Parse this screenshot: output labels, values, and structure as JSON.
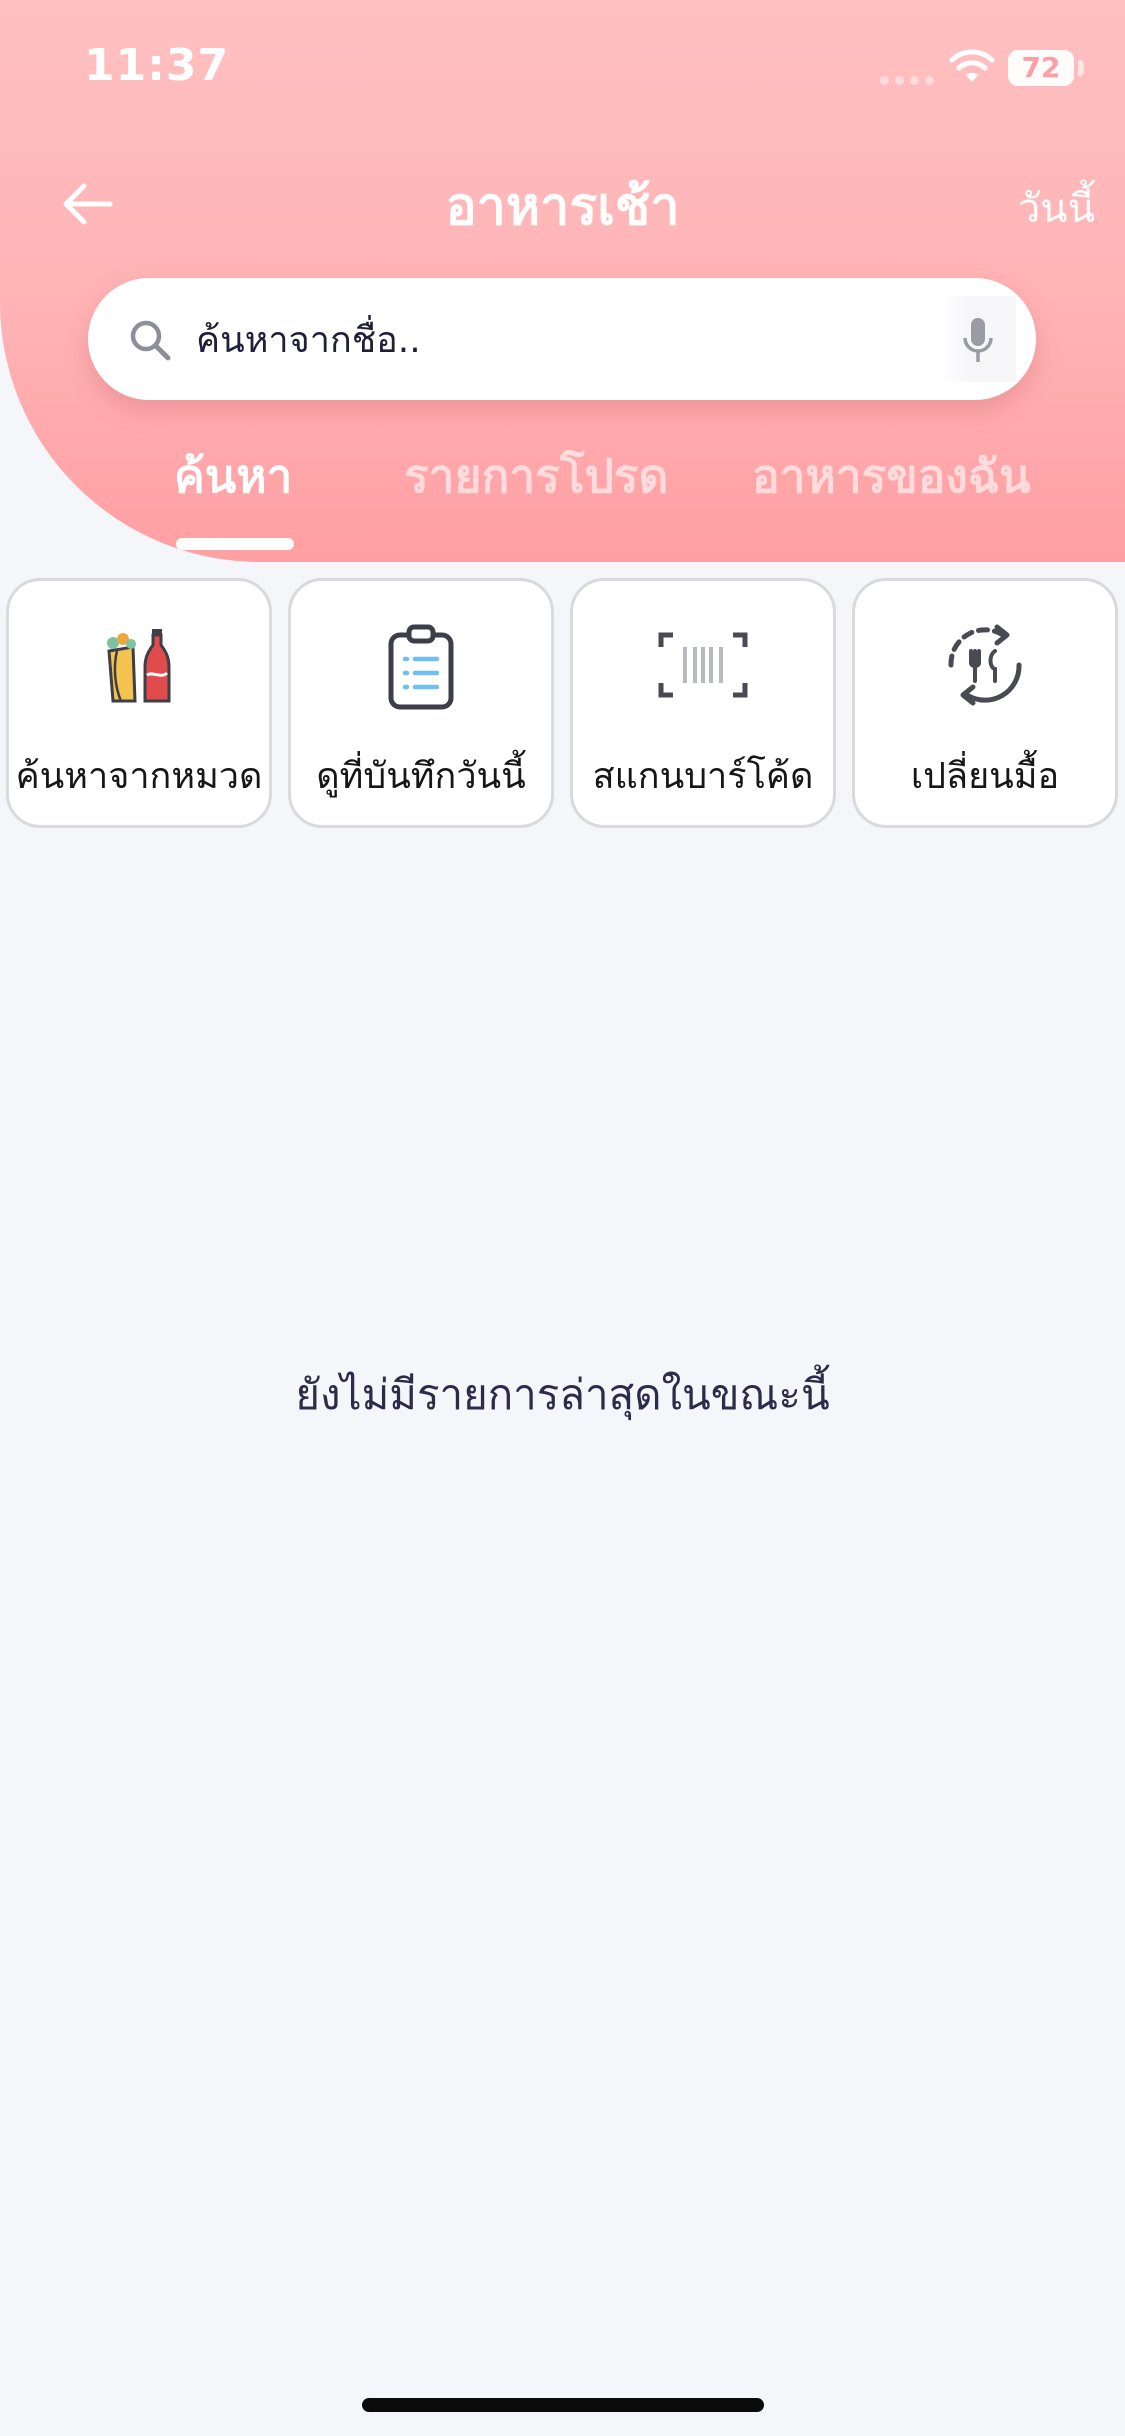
{
  "status_bar": {
    "time": "11:37",
    "battery": "72"
  },
  "header": {
    "title": "อาหารเช้า",
    "today_label": "วันนี้"
  },
  "search": {
    "placeholder": "ค้นหาจากชื่อ.."
  },
  "tabs": [
    {
      "label": "ค้นหา",
      "active": true
    },
    {
      "label": "รายการโปรด",
      "active": false
    },
    {
      "label": "อาหารของฉัน",
      "active": false
    }
  ],
  "quick_actions": [
    {
      "label": "ค้นหาจากหมวด",
      "icon": "food-drink-icon"
    },
    {
      "label": "ดูที่บันทึกวันนี้",
      "icon": "clipboard-list-icon"
    },
    {
      "label": "สแกนบาร์โค้ด",
      "icon": "barcode-scan-icon"
    },
    {
      "label": "เปลี่ยนมื้อ",
      "icon": "switch-meal-icon"
    }
  ],
  "empty_state": {
    "message": "ยังไม่มีรายการล่าสุดในขณะนี้"
  },
  "colors": {
    "header_top": "#ffc0c1",
    "header_bottom": "#ff9fa3",
    "background": "#f5f6fa",
    "card_border": "#d9d9de",
    "text_dark": "#2c2c4a"
  }
}
